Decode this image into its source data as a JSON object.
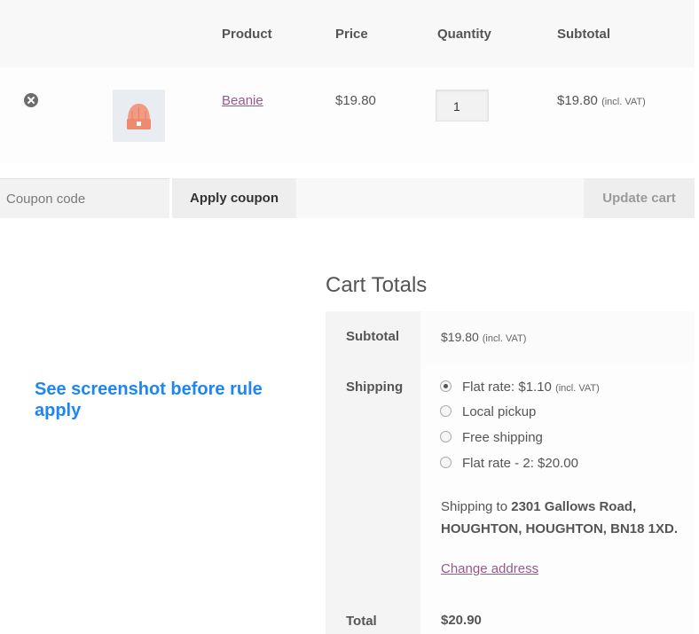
{
  "cart": {
    "headers": {
      "product": "Product",
      "price": "Price",
      "quantity": "Quantity",
      "subtotal": "Subtotal"
    },
    "item": {
      "name": "Beanie",
      "price": "$19.80",
      "quantity": "1",
      "subtotal": "$19.80",
      "subtotal_tax_note": "(incl. VAT)",
      "thumbnail_icon": "beanie-hat-icon",
      "remove_icon": "remove-circle-icon"
    }
  },
  "actions": {
    "coupon_placeholder": "Coupon code",
    "apply_coupon": "Apply coupon",
    "update_cart": "Update cart"
  },
  "annotation": "See screenshot before rule apply",
  "totals": {
    "title": "Cart Totals",
    "subtotal_label": "Subtotal",
    "subtotal_value": "$19.80",
    "subtotal_tax_note": "(incl. VAT)",
    "shipping_label": "Shipping",
    "shipping_options": [
      {
        "label": "Flat rate: $1.10",
        "note": "(incl. VAT)",
        "checked": true
      },
      {
        "label": "Local pickup",
        "note": "",
        "checked": false
      },
      {
        "label": "Free shipping",
        "note": "",
        "checked": false
      },
      {
        "label": "Flat rate - 2: $20.00",
        "note": "",
        "checked": false
      }
    ],
    "shipping_to_prefix": "Shipping to",
    "shipping_address": "2301 Gallows Road, HOUGHTON, HOUGHTON, BN18 1XD.",
    "change_address": "Change address",
    "total_label": "Total",
    "total_value": "$20.90"
  },
  "colors": {
    "link": "#96588a",
    "annotation": "#1e86f0",
    "beanie": "#f0937a"
  }
}
